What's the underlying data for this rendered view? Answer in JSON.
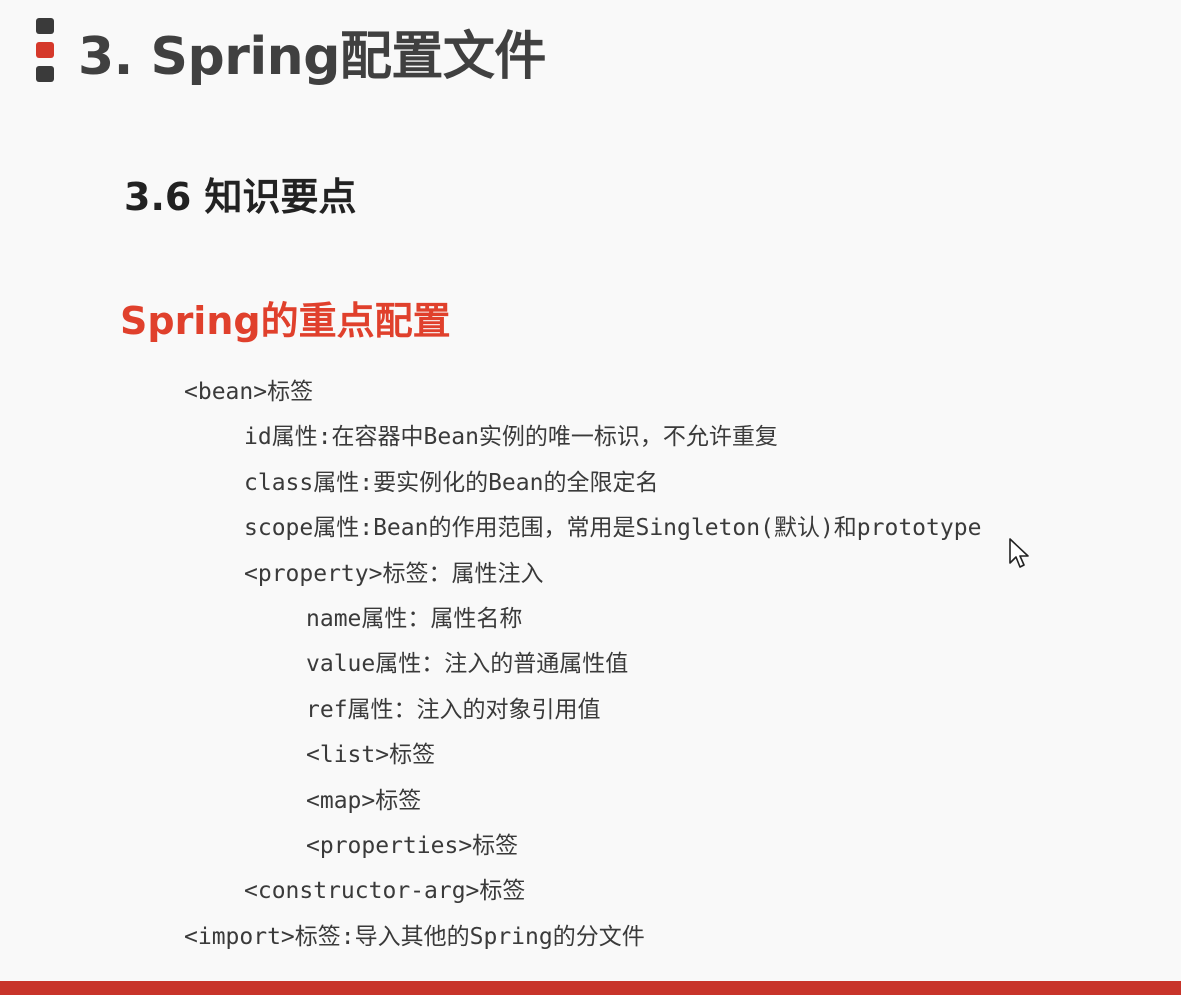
{
  "slide": {
    "main_title": "3. Spring配置文件",
    "sub_title": "3.6 知识要点",
    "section_title": "Spring的重点配置",
    "items": [
      {
        "level": 0,
        "text": "<bean>标签"
      },
      {
        "level": 1,
        "text": "id属性:在容器中Bean实例的唯一标识，不允许重复"
      },
      {
        "level": 1,
        "text": "class属性:要实例化的Bean的全限定名"
      },
      {
        "level": 1,
        "text": "scope属性:Bean的作用范围，常用是Singleton(默认)和prototype"
      },
      {
        "level": 1,
        "text": "<property>标签：属性注入"
      },
      {
        "level": 2,
        "text": "name属性：属性名称"
      },
      {
        "level": 2,
        "text": "value属性：注入的普通属性值"
      },
      {
        "level": 2,
        "text": "ref属性：注入的对象引用值"
      },
      {
        "level": 2,
        "text": "<list>标签"
      },
      {
        "level": 2,
        "text": "<map>标签"
      },
      {
        "level": 2,
        "text": "<properties>标签"
      },
      {
        "level": 1,
        "text": "<constructor-arg>标签"
      },
      {
        "level": 0,
        "text": "<import>标签:导入其他的Spring的分文件"
      }
    ]
  },
  "colors": {
    "accent": "#d5382a",
    "section_title": "#e0402c",
    "footer": "#c8342a"
  },
  "icons": {
    "title_marker": "three-stacked-squares-icon",
    "cursor": "mouse-pointer-icon"
  }
}
